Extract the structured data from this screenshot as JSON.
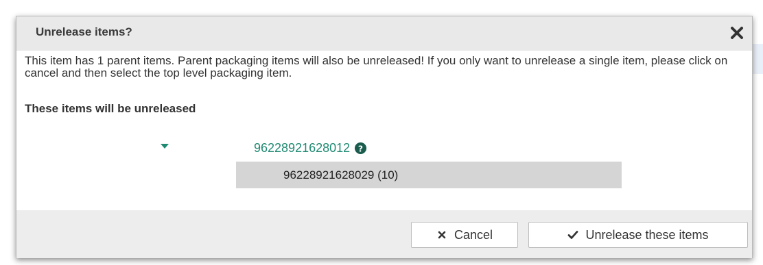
{
  "dialog": {
    "title": "Unrelease items?",
    "close_icon": "close-icon",
    "message": "This item has 1 parent items. Parent packaging items will also be unreleased! If you only want to unrelease a single item, please click on cancel and then select the top level packaging item.",
    "section_label": "These items will be unreleased"
  },
  "tree": {
    "parent": {
      "label": "96228921628012",
      "toggle_icon": "caret-down-icon",
      "help_icon": "question-circle-icon",
      "color": "#1f8a72"
    },
    "children": [
      {
        "label": "96228921628029 (10)"
      }
    ]
  },
  "footer": {
    "cancel_label": "Cancel",
    "cancel_icon": "x-icon",
    "confirm_label": "Unrelease these items",
    "confirm_icon": "checkmark-icon"
  }
}
